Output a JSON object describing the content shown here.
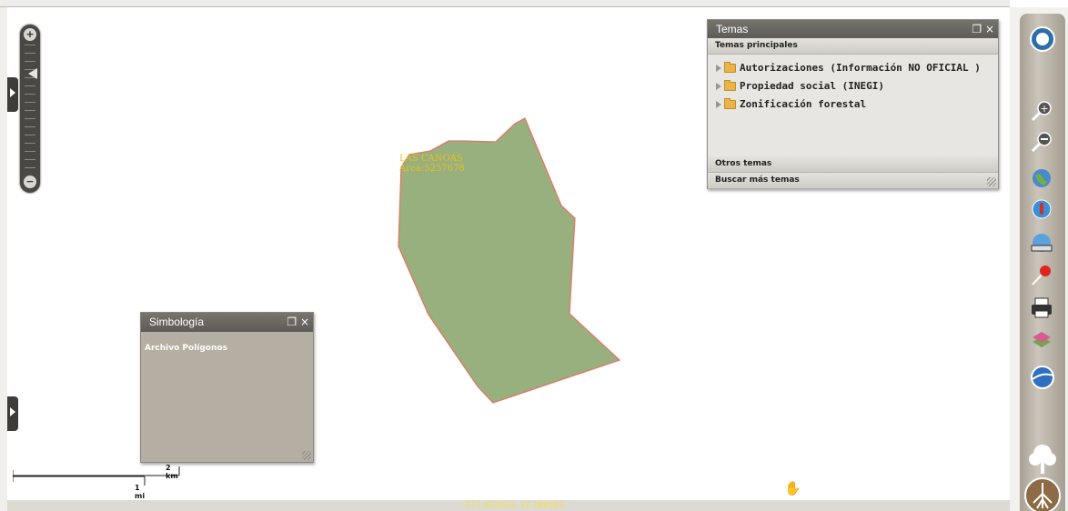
{
  "map": {
    "polygon": {
      "label_name": "LAS CANOAS",
      "label_area": "Área:5257678",
      "fill_color": "#97b07e",
      "stroke_color": "#e07868"
    },
    "coordinates": "-117.002003, 32.288581",
    "scale": {
      "km_label": "2 km",
      "mi_label": "1 mi"
    }
  },
  "zoom": {
    "plus_symbol": "+",
    "minus_symbol": "−"
  },
  "temas": {
    "title": "Temas",
    "restore_symbol": "❐",
    "close_symbol": "×",
    "main_section": "Temas principales",
    "items": [
      {
        "label": "Autorizaciones (Información NO OFICIAL )",
        "icon": "folder-icon"
      },
      {
        "label": "Propiedad social (INEGI)",
        "icon": "folder-icon"
      },
      {
        "label": "Zonificación forestal",
        "icon": "folder-icon"
      }
    ],
    "other_section": "Otros temas",
    "search_section": "Buscar más temas"
  },
  "simbologia": {
    "title": "Simbología",
    "restore_symbol": "❐",
    "close_symbol": "×",
    "content": "Archivo Polígonos"
  },
  "toolbar": {
    "tools": [
      "logo-icon",
      "zoom-in-icon",
      "zoom-out-icon",
      "globe-icon",
      "info-icon",
      "measure-icon",
      "pin-icon",
      "print-icon",
      "layers-icon",
      "google-earth-icon",
      "tree-icon",
      "roots-icon"
    ]
  },
  "cursor": "hand-icon"
}
